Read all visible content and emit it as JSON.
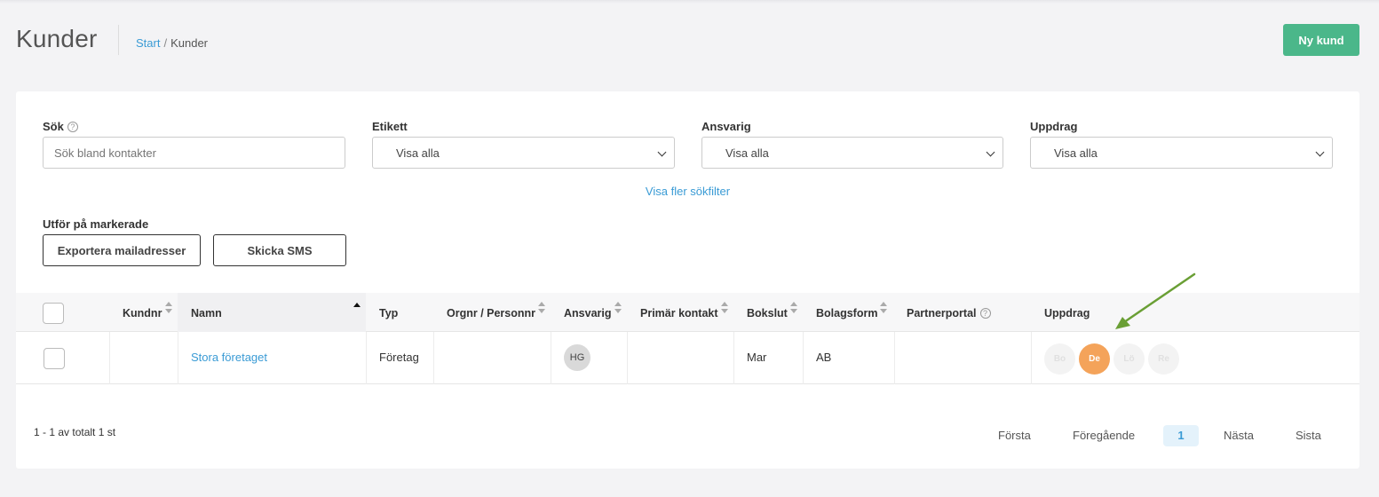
{
  "header": {
    "title": "Kunder",
    "breadcrumb": {
      "home": "Start",
      "separator": "/",
      "current": "Kunder"
    },
    "new_button": "Ny kund"
  },
  "filters": {
    "search": {
      "label": "Sök",
      "placeholder": "Sök bland kontakter",
      "help_icon": "?"
    },
    "tag": {
      "label": "Etikett",
      "value": "Visa alla"
    },
    "responsible": {
      "label": "Ansvarig",
      "value": "Visa alla"
    },
    "assignment": {
      "label": "Uppdrag",
      "value": "Visa alla"
    },
    "more_filters": "Visa fler sökfilter"
  },
  "bulk": {
    "label": "Utför på markerade",
    "export_button": "Exportera mailadresser",
    "sms_button": "Skicka SMS"
  },
  "table": {
    "columns": {
      "kundnr": "Kundnr",
      "namn": "Namn",
      "typ": "Typ",
      "orgnr": "Orgnr / Personnr",
      "ansvarig": "Ansvarig",
      "primar": "Primär kontakt",
      "bokslut": "Bokslut",
      "bolagsform": "Bolagsform",
      "partnerportal": "Partnerportal",
      "partnerportal_help": "?",
      "uppdrag": "Uppdrag"
    },
    "rows": [
      {
        "kundnr": "",
        "namn": "Stora företaget",
        "typ": "Företag",
        "orgnr": "",
        "ansvarig": "HG",
        "primar": "",
        "bokslut": "Mar",
        "bolagsform": "AB",
        "partnerportal": "",
        "uppdrag": [
          "Bo",
          "De",
          "Lö",
          "Re"
        ],
        "uppdrag_active": "De"
      }
    ]
  },
  "footer": {
    "count": "1 - 1 av totalt 1 st",
    "first": "Första",
    "prev": "Föregående",
    "page": "1",
    "next": "Nästa",
    "last": "Sista"
  },
  "colors": {
    "primary_button": "#4bb78a",
    "link": "#3a9bd5",
    "active_assignment": "#f4a35a",
    "arrow": "#6a9f35"
  }
}
